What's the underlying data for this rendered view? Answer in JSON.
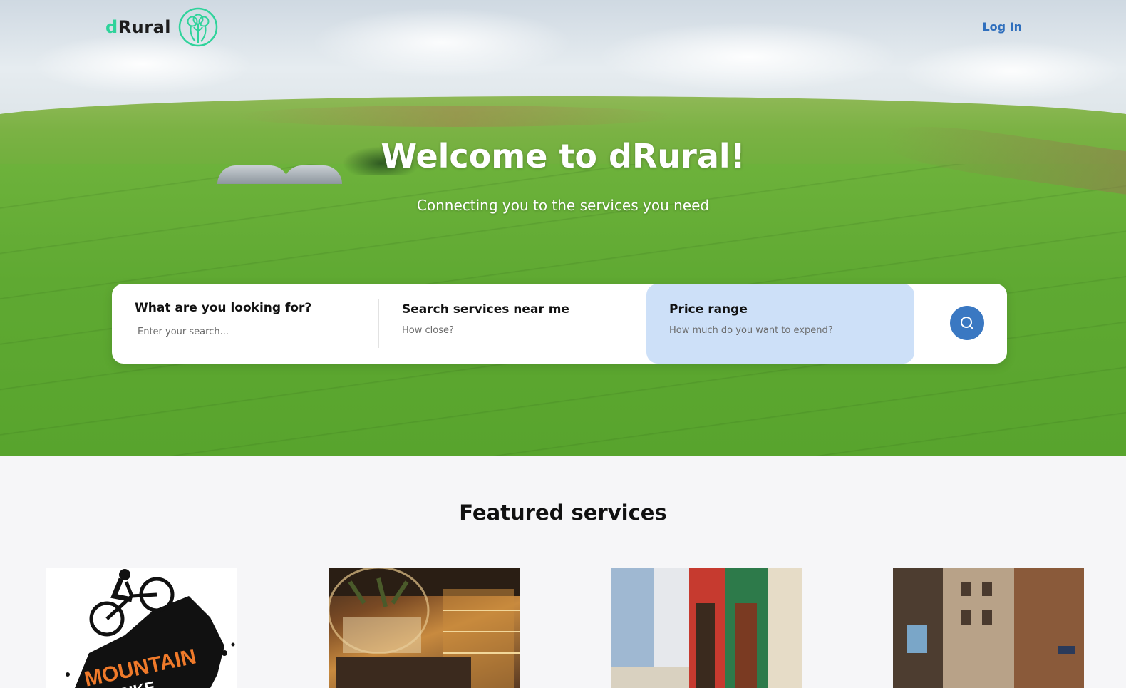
{
  "brand": {
    "name_prefix": "d",
    "name_rest": "Rural",
    "logo_icon": "drural-knot-logo-icon",
    "accent_color": "#2fd39b"
  },
  "nav": {
    "login_label": "Log In",
    "link_color": "#2f6fbd"
  },
  "hero": {
    "title": "Welcome to dRural!",
    "subtitle": "Connecting you to the services you need"
  },
  "search": {
    "what": {
      "label": "What are you looking for?",
      "placeholder": "Enter your search..."
    },
    "near": {
      "label": "Search services near me",
      "hint": "How close?"
    },
    "price": {
      "label": "Price range",
      "hint": "How much do you want to expend?",
      "highlight_color": "#cde0f8"
    },
    "button_icon": "search-icon",
    "button_color": "#3a78c2"
  },
  "featured": {
    "title": "Featured services",
    "cards": [
      {
        "image": "mountain-bike-logo",
        "text_line1": "MOUNTAIN",
        "text_line2": "BIKE"
      },
      {
        "image": "cocktail-bar-interior"
      },
      {
        "image": "colorful-street-facades"
      },
      {
        "image": "narrow-old-town-street"
      }
    ]
  }
}
